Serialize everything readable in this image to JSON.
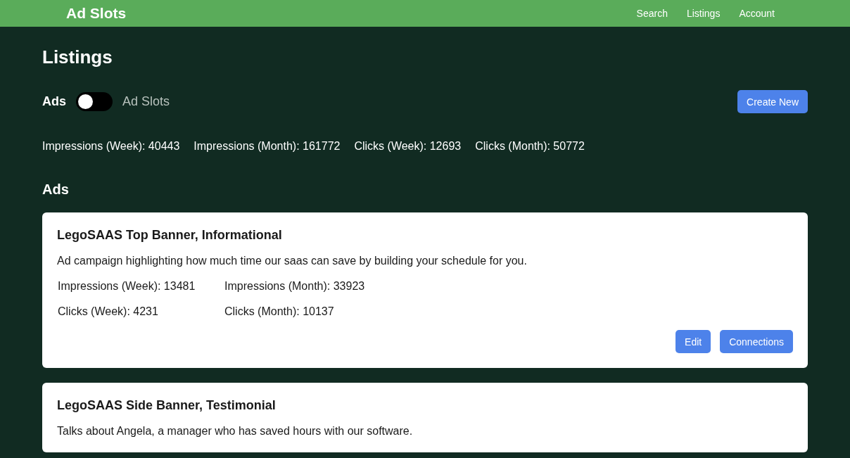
{
  "navbar": {
    "brand": "Ad Slots",
    "links": [
      "Search",
      "Listings",
      "Account"
    ]
  },
  "page_title": "Listings",
  "view_toggle": {
    "left_label": "Ads",
    "right_label": "Ad Slots",
    "on": false
  },
  "create_button": "Create New",
  "totals": [
    "Impressions (Week): 40443",
    "Impressions (Month): 161772",
    "Clicks (Week): 12693",
    "Clicks (Month): 50772"
  ],
  "section_title": "Ads",
  "ads": [
    {
      "title": "LegoSAAS Top Banner, Informational",
      "description": "Ad campaign highlighting how much time our saas can save by building your schedule for you.",
      "stats": [
        "Impressions (Week): 13481",
        "Impressions (Month): 33923",
        "Clicks (Week): 4231",
        "Clicks (Month): 10137"
      ],
      "buttons": [
        "Edit",
        "Connections"
      ]
    },
    {
      "title": "LegoSAAS Side Banner, Testimonial",
      "description": "Talks about Angela, a manager who has saved hours with our software."
    }
  ]
}
